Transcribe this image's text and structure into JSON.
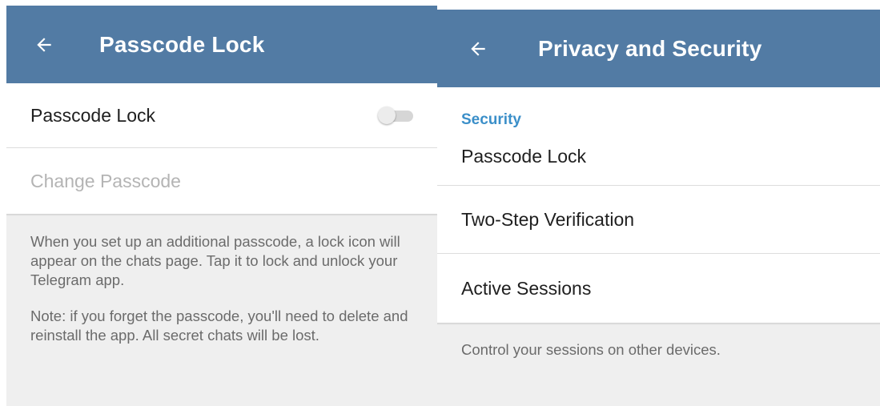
{
  "left_panel": {
    "header": {
      "back_icon": "arrow-left-icon",
      "title": "Passcode Lock"
    },
    "rows": {
      "passcode_lock_label": "Passcode Lock",
      "passcode_lock_enabled": false,
      "change_passcode_label": "Change Passcode"
    },
    "info": {
      "paragraph1": "When you set up an additional passcode, a lock icon will appear on the chats page. Tap it to lock and unlock your Telegram app.",
      "paragraph2": "Note: if you forget the passcode, you'll need to delete and reinstall the app. All secret chats will be lost."
    }
  },
  "right_panel": {
    "header": {
      "back_icon": "arrow-left-icon",
      "title": "Privacy and Security"
    },
    "section_label": "Security",
    "items": [
      {
        "label": "Passcode Lock"
      },
      {
        "label": "Two-Step Verification"
      },
      {
        "label": "Active Sessions"
      }
    ],
    "footer": "Control your sessions on other devices."
  },
  "colors": {
    "header": "#527ba4",
    "accent": "#3b8fc9",
    "background": "#efefef"
  }
}
